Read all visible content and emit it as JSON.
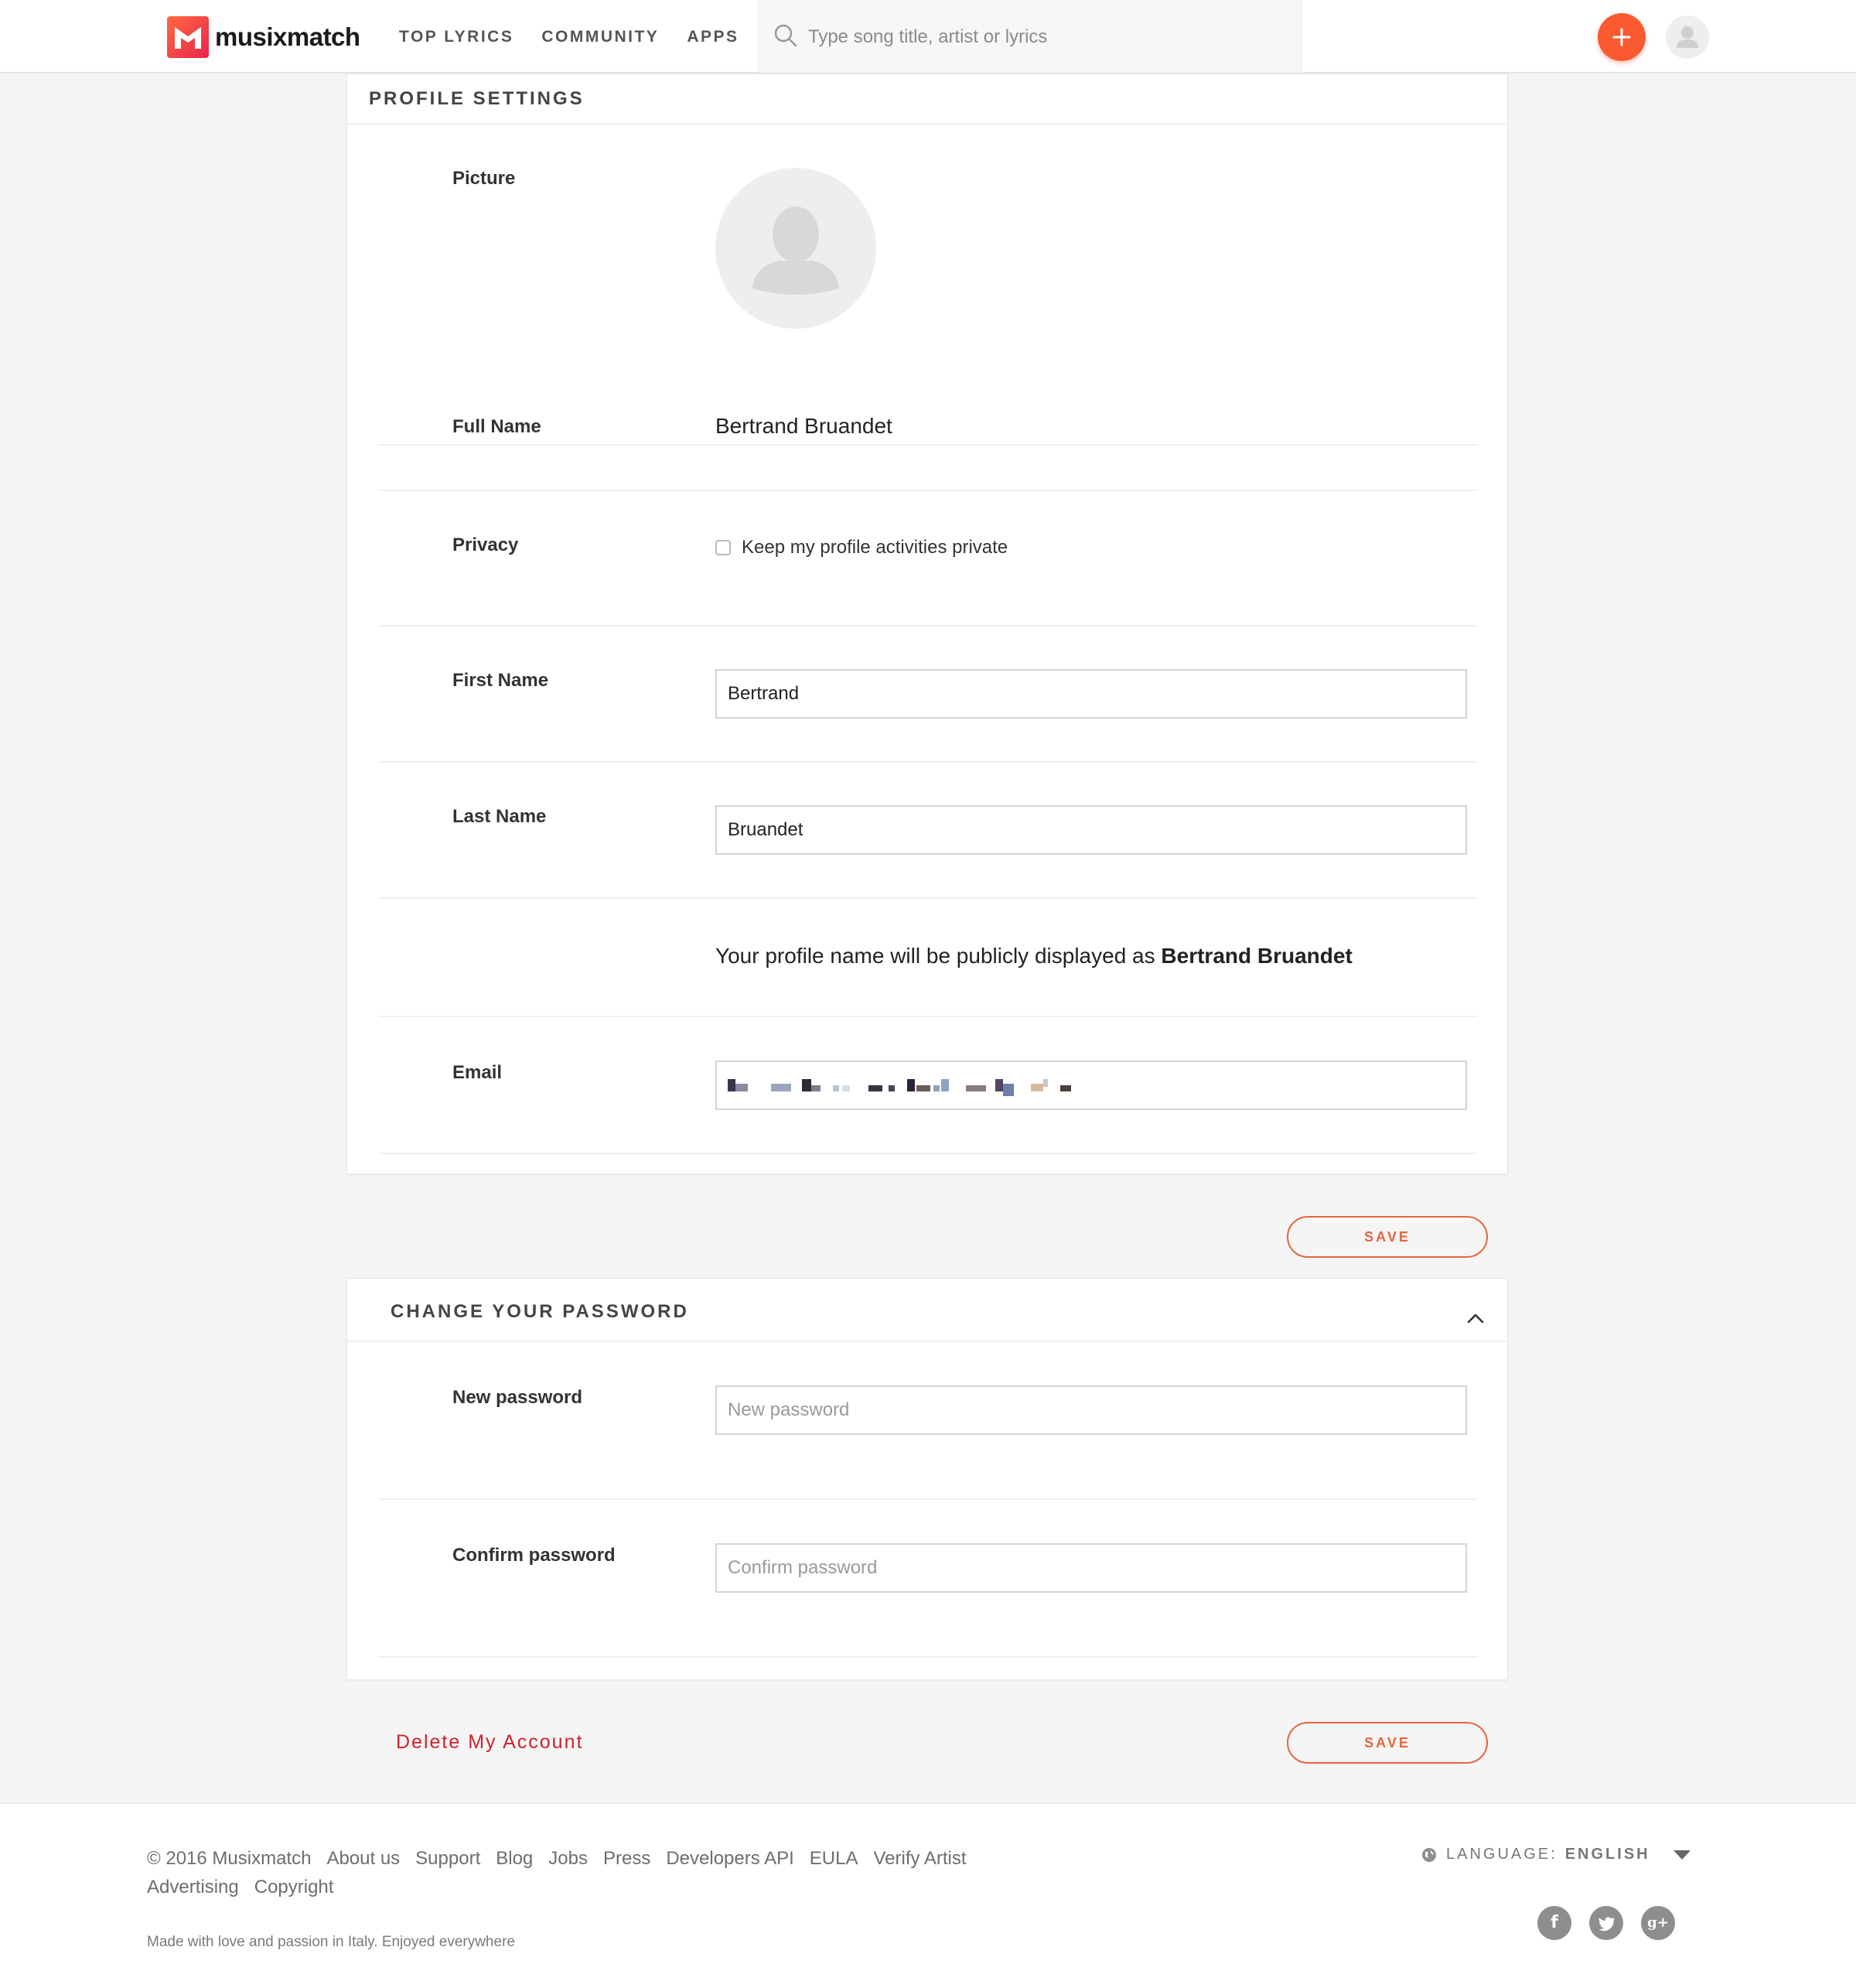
{
  "header": {
    "brand": "musixmatch",
    "nav": [
      "TOP LYRICS",
      "COMMUNITY",
      "APPS"
    ],
    "search_placeholder": "Type song title, artist or lyrics",
    "accent_color": "#fa5a30"
  },
  "profile": {
    "title": "PROFILE SETTINGS",
    "picture_label": "Picture",
    "full_name_label": "Full Name",
    "full_name": "Bertrand Bruandet",
    "privacy_label": "Privacy",
    "privacy_option": "Keep my profile activities private",
    "privacy_checked": false,
    "first_name_label": "First Name",
    "first_name": "Bertrand",
    "last_name_label": "Last Name",
    "last_name": "Bruandet",
    "public_name_prefix": "Your profile name will be publicly displayed as",
    "public_name": "Bertrand Bruandet",
    "email_label": "Email",
    "save_label": "SAVE"
  },
  "password": {
    "title": "CHANGE YOUR PASSWORD",
    "new_label": "New password",
    "new_placeholder": "New password",
    "confirm_label": "Confirm password",
    "confirm_placeholder": "Confirm password",
    "save_label": "SAVE"
  },
  "delete_account": "Delete My Account",
  "footer": {
    "copyright": "© 2016 Musixmatch",
    "links": [
      "About us",
      "Support",
      "Blog",
      "Jobs",
      "Press",
      "Developers API",
      "EULA",
      "Verify Artist",
      "Advertising",
      "Copyright"
    ],
    "tagline": "Made with love and passion in Italy. Enjoyed everywhere",
    "language_label": "LANGUAGE:",
    "language_value": "ENGLISH",
    "socials": [
      "facebook-icon",
      "twitter-icon",
      "google-plus-icon"
    ]
  }
}
